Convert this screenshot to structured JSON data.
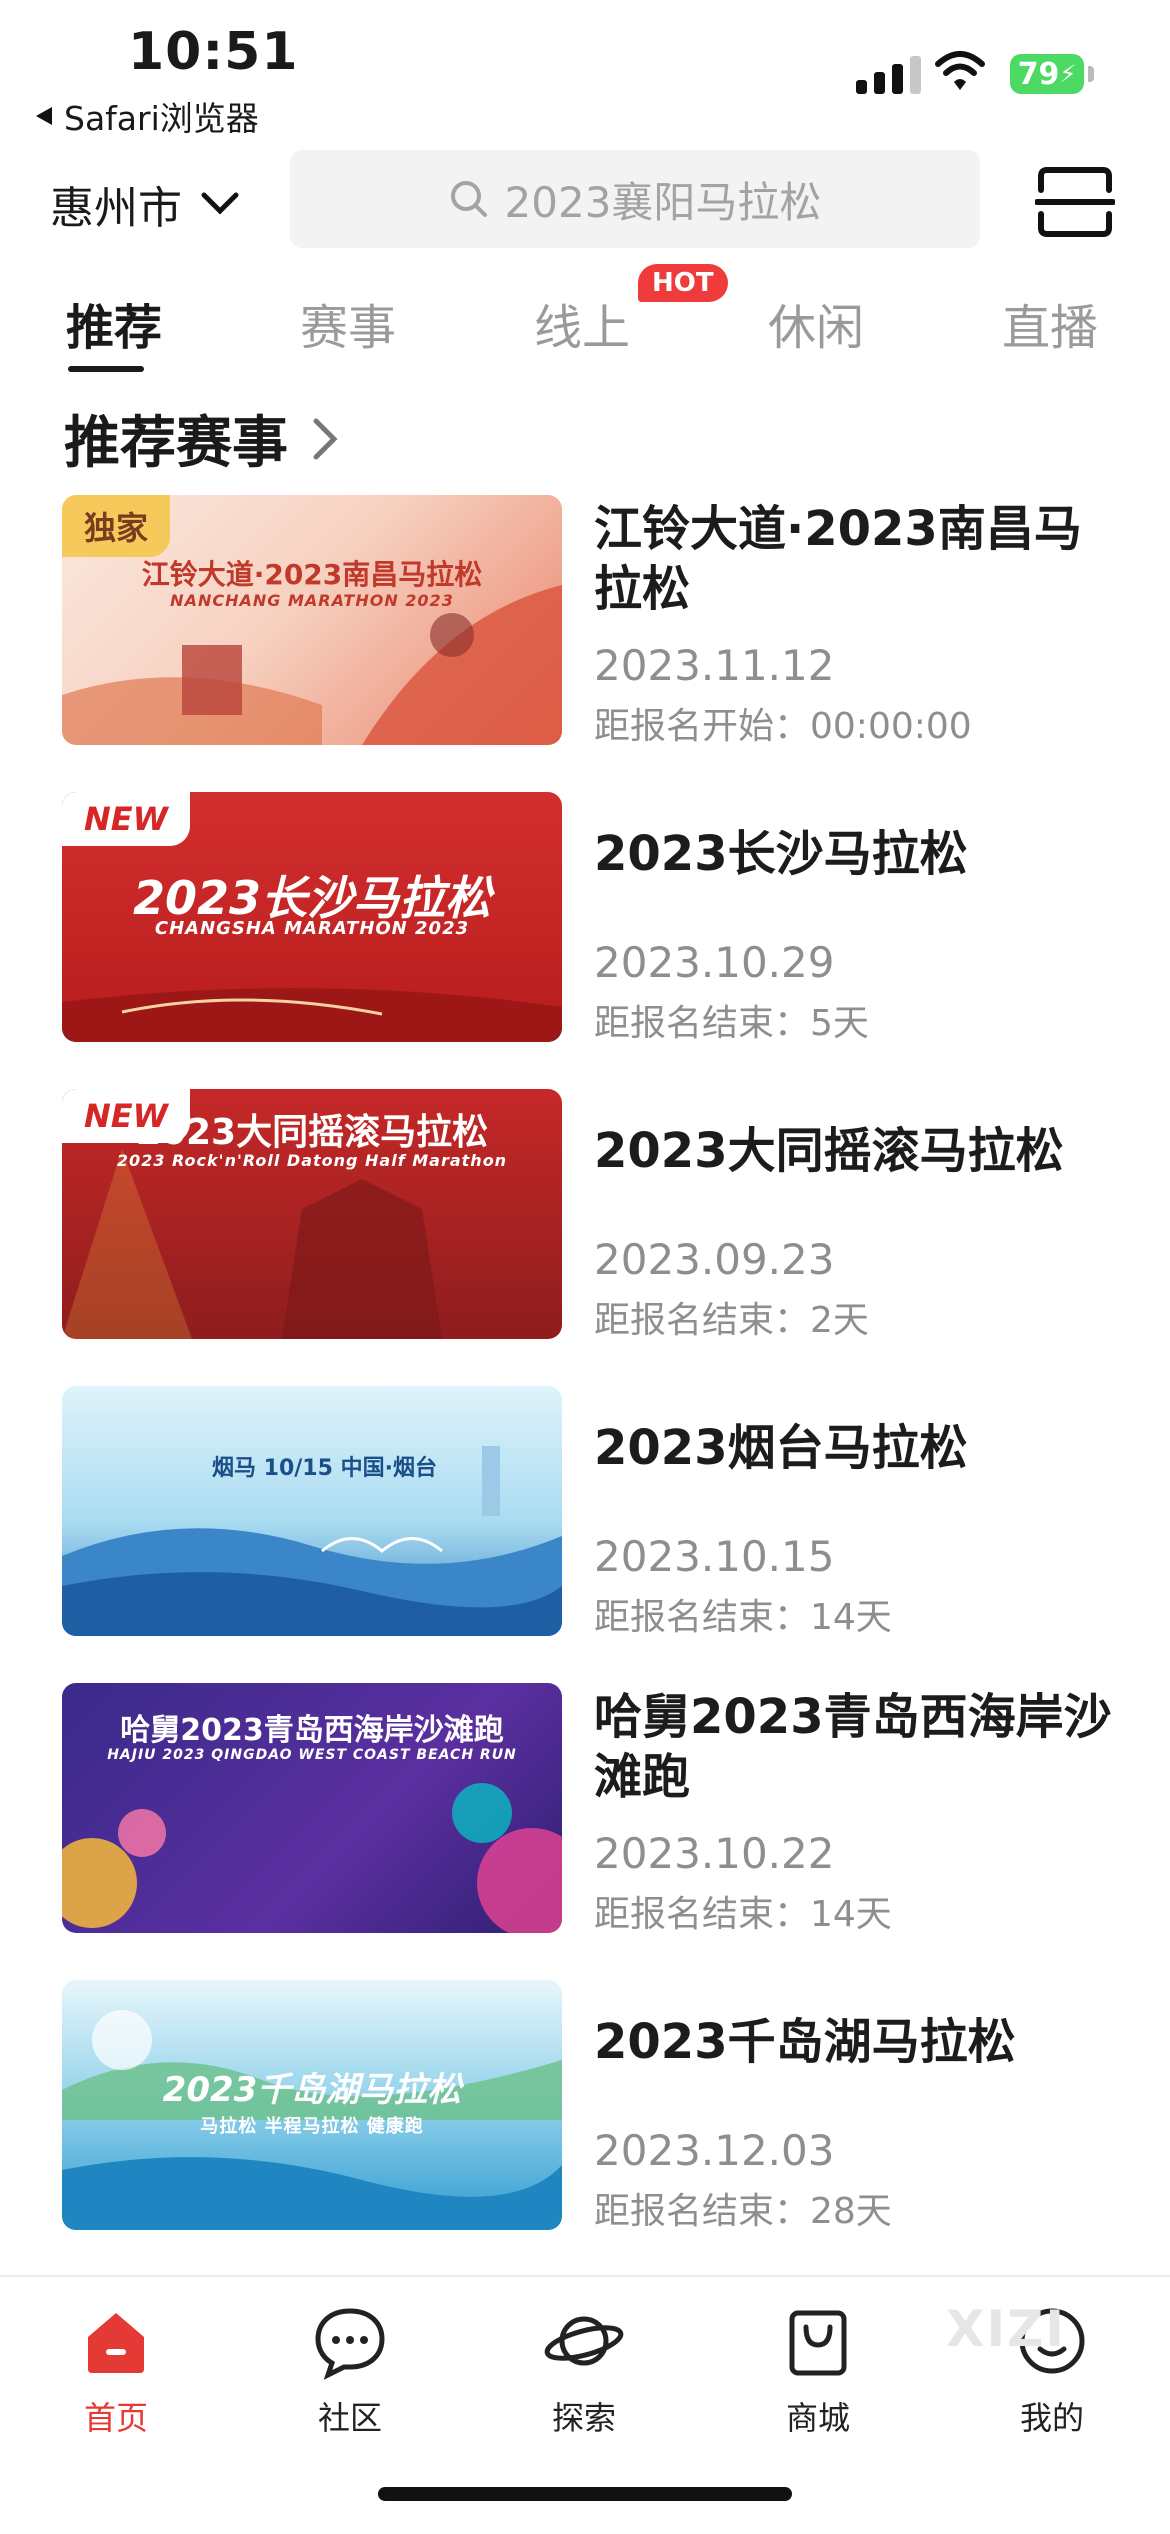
{
  "status_bar": {
    "time": "10:51",
    "back_app": "Safari浏览器",
    "battery": "79"
  },
  "header": {
    "city": "惠州市",
    "search_placeholder": "2023襄阳马拉松"
  },
  "tabs": [
    {
      "label": "推荐",
      "active": true
    },
    {
      "label": "赛事",
      "active": false
    },
    {
      "label": "线上",
      "active": false,
      "badge": "HOT"
    },
    {
      "label": "休闲",
      "active": false
    },
    {
      "label": "直播",
      "active": false
    }
  ],
  "section_title": "推荐赛事",
  "events": [
    {
      "badge": "独家",
      "title": "江铃大道·2023南昌马拉松",
      "date": "2023.11.12",
      "registration": "距报名开始：00:00:00",
      "thumb_title": "江铃大道·2023南昌马拉松",
      "thumb_sub": "NANCHANG MARATHON 2023"
    },
    {
      "badge": "NEW",
      "title": "2023长沙马拉松",
      "date": "2023.10.29",
      "registration": "距报名结束：5天",
      "thumb_title": "2023长沙马拉松",
      "thumb_sub": "CHANGSHA MARATHON 2023"
    },
    {
      "badge": "NEW",
      "title": "2023大同摇滚马拉松",
      "date": "2023.09.23",
      "registration": "距报名结束：2天",
      "thumb_title": "2023大同摇滚马拉松",
      "thumb_sub": "2023 Rock'n'Roll Datong Half Marathon"
    },
    {
      "badge": "",
      "title": "2023烟台马拉松",
      "date": "2023.10.15",
      "registration": "距报名结束：14天",
      "thumb_title": "烟马 10/15 中国·烟台",
      "thumb_sub": ""
    },
    {
      "badge": "",
      "title": "哈舅2023青岛西海岸沙滩跑",
      "date": "2023.10.22",
      "registration": "距报名结束：14天",
      "thumb_title": "哈舅2023青岛西海岸沙滩跑",
      "thumb_sub": "HAJIU 2023 QINGDAO WEST COAST BEACH RUN"
    },
    {
      "badge": "",
      "title": "2023千岛湖马拉松",
      "date": "2023.12.03",
      "registration": "距报名结束：28天",
      "thumb_title": "2023千岛湖马拉松",
      "thumb_sub": "马拉松 半程马拉松 健康跑"
    }
  ],
  "tabbar": [
    {
      "label": "首页",
      "icon": "home-icon",
      "active": true
    },
    {
      "label": "社区",
      "icon": "chat-bubble-icon",
      "active": false
    },
    {
      "label": "探索",
      "icon": "planet-icon",
      "active": false
    },
    {
      "label": "商城",
      "icon": "shopping-bag-icon",
      "active": false
    },
    {
      "label": "我的",
      "icon": "profile-icon",
      "active": false
    }
  ],
  "watermark": "XIZI",
  "colors": {
    "accent": "#e53935",
    "hot_badge": "#ef3b3b",
    "gold_badge": "#f6c95b"
  }
}
